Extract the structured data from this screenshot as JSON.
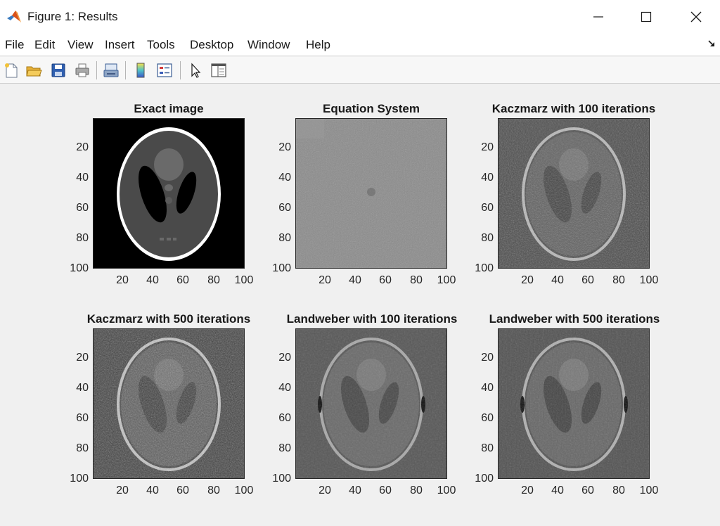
{
  "window": {
    "title": "Figure 1: Results",
    "minimize_label": "minimize",
    "maximize_label": "maximize",
    "close_label": "close"
  },
  "menu": {
    "items": [
      "File",
      "Edit",
      "View",
      "Insert",
      "Tools",
      "Desktop",
      "Window",
      "Help"
    ]
  },
  "toolbar": {
    "icons": [
      "new-figure-icon",
      "open-file-icon",
      "save-icon",
      "print-icon",
      "link-plot-icon",
      "insert-colorbar-icon",
      "insert-legend-icon",
      "edit-plot-pointer-icon",
      "property-inspector-icon"
    ]
  },
  "axes": {
    "x_ticks": [
      "20",
      "40",
      "60",
      "80",
      "100"
    ],
    "y_ticks": [
      "20",
      "40",
      "60",
      "80",
      "100"
    ],
    "titles": [
      "Exact image",
      "Equation System",
      "Kaczmarz with 100 iterations",
      "Kaczmarz with 500 iterations",
      "Landweber with 100 iterations",
      "Landweber with 500 iterations"
    ]
  },
  "colors": {
    "titlebar_bg": "#ffffff",
    "figure_bg": "#f0f0f0",
    "text": "#1a1a1a"
  }
}
